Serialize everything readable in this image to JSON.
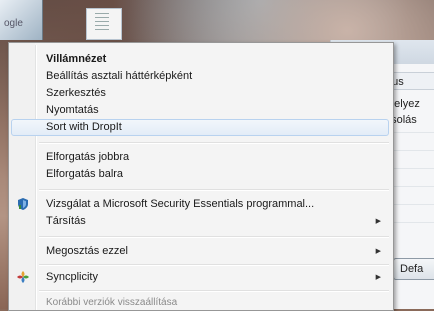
{
  "background": {
    "left_thumb_glyph": "ogle"
  },
  "dialog": {
    "column_header": "pus",
    "cells": [
      "thelyez",
      "ásolás"
    ],
    "default_button": "Defa"
  },
  "menu": {
    "items": [
      {
        "label": "Villámnézet",
        "bold": true
      },
      {
        "label": "Beállítás asztali háttérképként"
      },
      {
        "label": "Szerkesztés"
      },
      {
        "label": "Nyomtatás"
      },
      {
        "label": "Sort with DropIt",
        "highlighted": true
      },
      {
        "label": "Elforgatás jobbra"
      },
      {
        "label": "Elforgatás balra"
      },
      {
        "label": "Vizsgálat a Microsoft Security Essentials programmal...",
        "icon": "security-essentials-icon"
      },
      {
        "label": "Társítás",
        "submenu": true
      },
      {
        "label": "Megosztás ezzel",
        "submenu": true
      },
      {
        "label": "Syncplicity",
        "submenu": true,
        "icon": "syncplicity-icon"
      },
      {
        "label": "Korábbi verziók visszaállítása"
      }
    ]
  },
  "colors": {
    "highlight_border": "#b8d2ef",
    "menu_bg": "#f4f4f4"
  }
}
